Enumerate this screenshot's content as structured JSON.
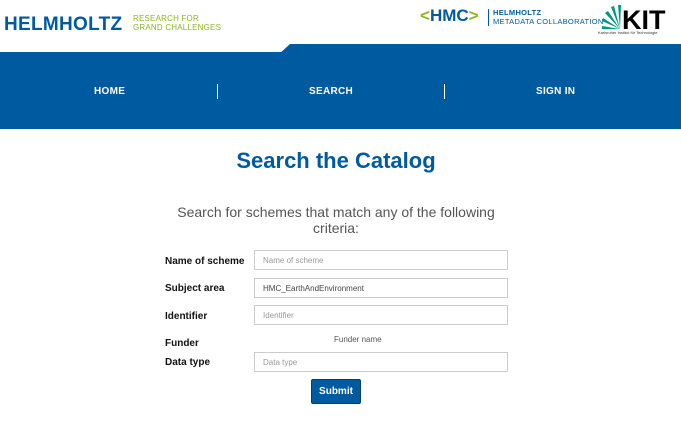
{
  "header": {
    "helmholtz_logo": "HELMHOLTZ",
    "tagline_line1": "RESEARCH FOR",
    "tagline_line2": "GRAND CHALLENGES",
    "hmc_logo": "HMC",
    "hmc_line1": "HELMHOLTZ",
    "hmc_line2": "METADATA COLLABORATION",
    "kit_logo": "KIT",
    "kit_subtitle": "Karlsruher Institut für Technologie"
  },
  "nav": {
    "home": "HOME",
    "search": "SEARCH",
    "signin": "SIGN IN"
  },
  "main": {
    "title": "Search the Catalog",
    "subtitle": "Search for schemes that match any of the following criteria:"
  },
  "form": {
    "name_label": "Name of scheme",
    "name_placeholder": "Name of scheme",
    "subject_label": "Subject area",
    "subject_value": "HMC_EarthAndEnvironment",
    "identifier_label": "Identifier",
    "identifier_placeholder": "Identifier",
    "funder_label": "Funder",
    "funder_text": "Funder name",
    "datatype_label": "Data type",
    "datatype_placeholder": "Data type",
    "submit_label": "Submit"
  },
  "colors": {
    "brand_blue": "#005aa0",
    "brand_green": "#8cb423"
  }
}
